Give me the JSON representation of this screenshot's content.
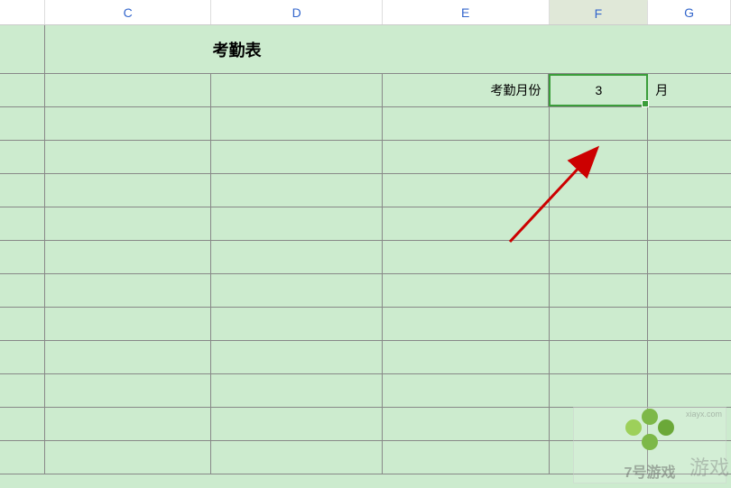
{
  "columns": {
    "c": "C",
    "d": "D",
    "e": "E",
    "f": "F",
    "g": "G"
  },
  "sheet": {
    "title": "考勤表",
    "month_label": "考勤月份",
    "month_value": "3",
    "month_suffix": "月"
  },
  "watermark": {
    "brand": "7号游戏",
    "url": "xiayx.com",
    "side": "游戏"
  },
  "chart_data": {
    "type": "table",
    "title": "考勤表",
    "note": "Spreadsheet attendance sheet with selected cell F showing month value 3",
    "cells": [
      {
        "row": 1,
        "merged": "A:G",
        "value": "考勤表"
      },
      {
        "row": 2,
        "col": "E",
        "value": "考勤月份"
      },
      {
        "row": 2,
        "col": "F",
        "value": 3,
        "selected": true
      },
      {
        "row": 2,
        "col": "G",
        "value": "月"
      }
    ]
  }
}
